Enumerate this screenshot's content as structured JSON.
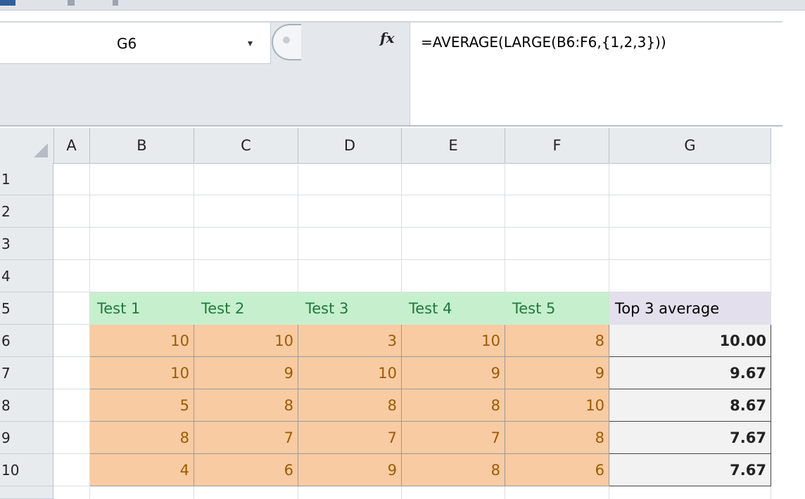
{
  "formula_bar": {
    "name_box": "G6",
    "dropdown_glyph": "▾",
    "fx_label": "fx",
    "formula": "=AVERAGE(LARGE(B6:F6,{1,2,3}))"
  },
  "columns": [
    "A",
    "B",
    "C",
    "D",
    "E",
    "F",
    "G"
  ],
  "row_numbers": [
    "1",
    "2",
    "3",
    "4",
    "5",
    "6",
    "7",
    "8",
    "9",
    "10"
  ],
  "table": {
    "headers": [
      "Test 1",
      "Test 2",
      "Test 3",
      "Test 4",
      "Test 5",
      "Top 3 average"
    ],
    "rows": [
      {
        "scores": [
          "10",
          "10",
          "3",
          "10",
          "8"
        ],
        "top3": "10.00"
      },
      {
        "scores": [
          "10",
          "9",
          "10",
          "9",
          "9"
        ],
        "top3": "9.67"
      },
      {
        "scores": [
          "5",
          "8",
          "8",
          "8",
          "10"
        ],
        "top3": "8.67"
      },
      {
        "scores": [
          "8",
          "7",
          "7",
          "7",
          "8"
        ],
        "top3": "7.67"
      },
      {
        "scores": [
          "4",
          "6",
          "9",
          "8",
          "6"
        ],
        "top3": "7.67"
      }
    ]
  },
  "colors": {
    "header_fill": "#c6efce",
    "header_text": "#1f7a3a",
    "score_fill": "#f8cba3",
    "score_text": "#9c5a00",
    "top3_header_fill": "#e4dfec",
    "result_fill": "#f2f2f2"
  },
  "icons": {
    "corner": "select-all-triangle",
    "cancel": "cancel-icon"
  }
}
